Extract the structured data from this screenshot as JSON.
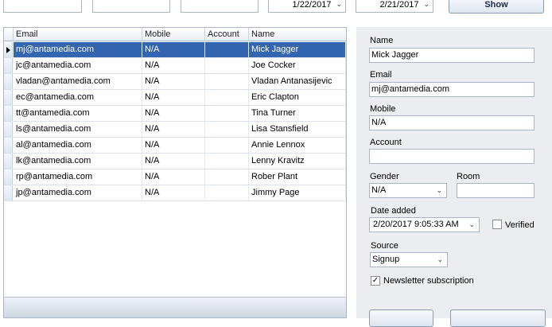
{
  "filters": {
    "box1": "",
    "box2": "",
    "box3": "",
    "date_from": "1/22/2017",
    "date_to": "2/21/2017",
    "show_label": "Show"
  },
  "grid": {
    "columns": [
      "Email",
      "Mobile",
      "Account",
      "Name"
    ],
    "selected_row": 0,
    "rows": [
      {
        "email": "mj@antamedia.com",
        "mobile": "N/A",
        "account": "",
        "name": "Mick Jagger"
      },
      {
        "email": "jc@antamedia.com",
        "mobile": "N/A",
        "account": "",
        "name": "Joe Cocker"
      },
      {
        "email": "vladan@antamedia.com",
        "mobile": "N/A",
        "account": "",
        "name": "Vladan Antanasijevic"
      },
      {
        "email": "ec@antamedia.com",
        "mobile": "N/A",
        "account": "",
        "name": "Eric Clapton"
      },
      {
        "email": "tt@antamedia.com",
        "mobile": "N/A",
        "account": "",
        "name": "Tina Turner"
      },
      {
        "email": "ls@antamedia.com",
        "mobile": "N/A",
        "account": "",
        "name": "Lisa Stansfield"
      },
      {
        "email": "al@antamedia.com",
        "mobile": "N/A",
        "account": "",
        "name": "Annie Lennox"
      },
      {
        "email": "lk@antamedia.com",
        "mobile": "N/A",
        "account": "",
        "name": "Lenny Kravitz"
      },
      {
        "email": "rp@antamedia.com",
        "mobile": "N/A",
        "account": "",
        "name": "Rober Plant"
      },
      {
        "email": "jp@antamedia.com",
        "mobile": "N/A",
        "account": "",
        "name": "Jimmy Page"
      }
    ]
  },
  "details": {
    "name_label": "Name",
    "name_value": "Mick Jagger",
    "email_label": "Email",
    "email_value": "mj@antamedia.com",
    "mobile_label": "Mobile",
    "mobile_value": "N/A",
    "account_label": "Account",
    "account_value": "",
    "gender_label": "Gender",
    "gender_value": "N/A",
    "room_label": "Room",
    "room_value": "",
    "date_added_label": "Date added",
    "date_added_value": "2/20/2017 9:05:33 AM",
    "verified_label": "Verified",
    "verified_checked": false,
    "source_label": "Source",
    "source_value": "Signup",
    "newsletter_label": "Newsletter subscription",
    "newsletter_checked": true
  },
  "colors": {
    "selection": "#3465b0",
    "panel_bg": "#ebedf0",
    "border": "#a9b6c6"
  },
  "icons": [
    "chevron-down-icon",
    "row-indicator-arrow-icon",
    "checkmark-icon"
  ]
}
